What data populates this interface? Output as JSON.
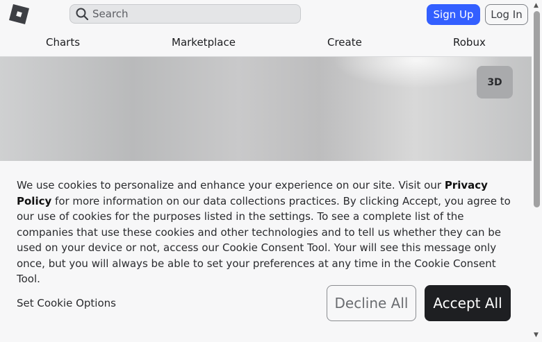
{
  "header": {
    "logo_icon": "roblox-logo-icon",
    "search": {
      "placeholder": "Search",
      "icon": "search-icon"
    },
    "signup_label": "Sign Up",
    "login_label": "Log In"
  },
  "nav": {
    "items": [
      {
        "label": "Charts"
      },
      {
        "label": "Marketplace"
      },
      {
        "label": "Create"
      },
      {
        "label": "Robux"
      }
    ]
  },
  "hero": {
    "toggle_3d_label": "3D"
  },
  "cookie_banner": {
    "text_before_link": "We use cookies to personalize and enhance your experience on our site. Visit our ",
    "link_text": "Privacy Policy",
    "text_after_link": " for more information on our data collections practices. By clicking Accept, you agree to our use of cookies for the purposes listed in the settings. To see a complete list of the companies that use these cookies and other technologies and to tell us whether they can be used on your device or not, access our Cookie Consent Tool. Your will see this message only once, but you will always be able to set your preferences at any time in the Cookie Consent Tool.",
    "set_options_label": "Set Cookie Options",
    "decline_label": "Decline All",
    "accept_label": "Accept All"
  },
  "colors": {
    "primary_blue": "#335fff",
    "accept_button": "#1e1f22",
    "background": "#f7f7f8"
  }
}
